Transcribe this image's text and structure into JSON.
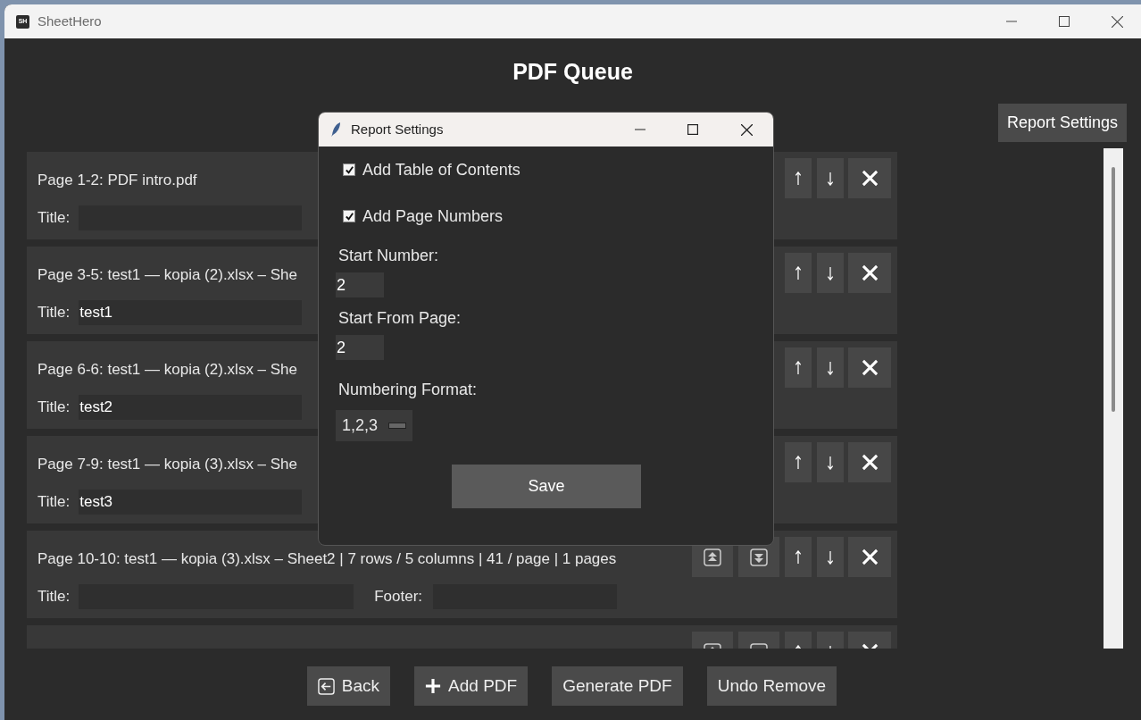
{
  "window": {
    "title": "SheetHero",
    "icon_text": "SH"
  },
  "heading": "PDF Queue",
  "report_settings_button": "Report Settings",
  "queue": [
    {
      "kind": "full",
      "header": "Page 1-2: PDF intro.pdf",
      "title_label": "Title:"
    },
    {
      "kind": "full",
      "header": "Page 3-5: test1 — kopia (2).xlsx – She",
      "title_label": "Title:",
      "title_value": "test1"
    },
    {
      "kind": "full",
      "header": "Page 6-6: test1 — kopia (2).xlsx – She",
      "title_label": "Title:",
      "title_value": "test2"
    },
    {
      "kind": "full",
      "header": "Page 7-9: test1 — kopia (3).xlsx – She",
      "title_label": "Title:",
      "title_value": "test3"
    },
    {
      "kind": "full",
      "header": "Page 10-10: test1 — kopia (3).xlsx – Sheet2 | 7 rows / 5 columns | 41 / page | 1 pages",
      "title_label": "Title:",
      "footer_label": "Footer:"
    },
    {
      "kind": "clipped"
    }
  ],
  "dialog": {
    "title": "Report Settings",
    "checkboxes": [
      {
        "label": "Add Table of Contents",
        "checked": true
      },
      {
        "label": "Add Page Numbers",
        "checked": true
      }
    ],
    "fields": [
      {
        "label": "Start Number:",
        "value": "2"
      },
      {
        "label": "Start From Page:",
        "value": "2"
      }
    ],
    "numbering_format": {
      "label": "Numbering Format:",
      "value": "1,2,3"
    },
    "save_button": "Save"
  },
  "bottom_buttons": [
    {
      "label": "Back",
      "kind": "back"
    },
    {
      "label": "Add PDF",
      "kind": "add"
    },
    {
      "label": "Generate PDF",
      "kind": "plain"
    },
    {
      "label": "Undo Remove",
      "kind": "plain"
    }
  ]
}
